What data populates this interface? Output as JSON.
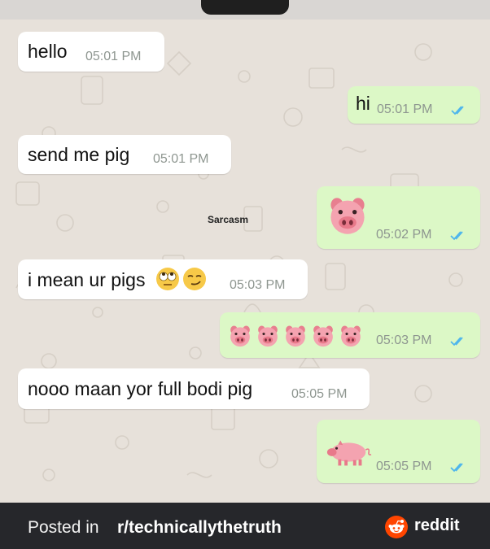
{
  "colors": {
    "incoming_bubble": "#ffffff",
    "outgoing_bubble": "#dcf8c6",
    "chat_background": "#e7e1da",
    "read_ticks": "#4fb6ec",
    "footer_background": "#26272b",
    "reddit_orange": "#ff4500"
  },
  "messages": [
    {
      "direction": "incoming",
      "text": "hello",
      "time": "05:01 PM"
    },
    {
      "direction": "outgoing",
      "text": "hi",
      "time": "05:01 PM",
      "status": "read-double-tick"
    },
    {
      "direction": "incoming",
      "text": "send me pig",
      "time": "05:01 PM"
    },
    {
      "direction": "outgoing",
      "content": "pig-face-emoji",
      "time": "05:02 PM",
      "status": "read-double-tick"
    },
    {
      "direction": "incoming",
      "text": "i mean ur pigs",
      "emojis": [
        "rolling-eyes-emoji",
        "smirk-emoji"
      ],
      "time": "05:03 PM"
    },
    {
      "direction": "outgoing",
      "content": "pig-face-emoji x5",
      "time": "05:03 PM",
      "status": "read-double-tick"
    },
    {
      "direction": "incoming",
      "text": "nooo maan yor full bodi pig",
      "time": "05:05 PM"
    },
    {
      "direction": "outgoing",
      "content": "full-pig-emoji",
      "time": "05:05 PM",
      "status": "read-double-tick"
    }
  ],
  "overlay_label": "Sarcasm",
  "footer": {
    "prefix": "Posted in ",
    "subreddit": "r/technicallythetruth",
    "brand": "reddit"
  }
}
